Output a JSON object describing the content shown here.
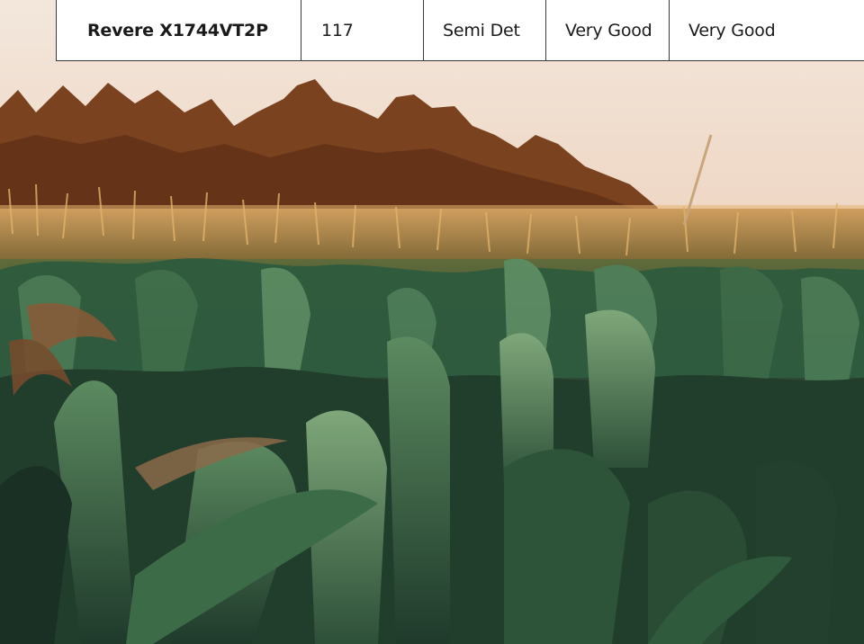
{
  "table_row": {
    "hybrid": "Revere X1744VT2P",
    "relative_maturity": "117",
    "plant_type": "Semi Det",
    "rating_1": "Very Good",
    "rating_2": "Very Good"
  },
  "colors": {
    "sky": "#f1e3d6",
    "treeline": "#7a3d1c",
    "tassels": "#d7a15f",
    "corn_leaf_dark": "#1f3b2c",
    "corn_leaf_mid": "#3f6a47",
    "corn_leaf_light": "#6f9a6c",
    "table_bg": "#ffffff",
    "table_border": "#3a3a3a"
  }
}
